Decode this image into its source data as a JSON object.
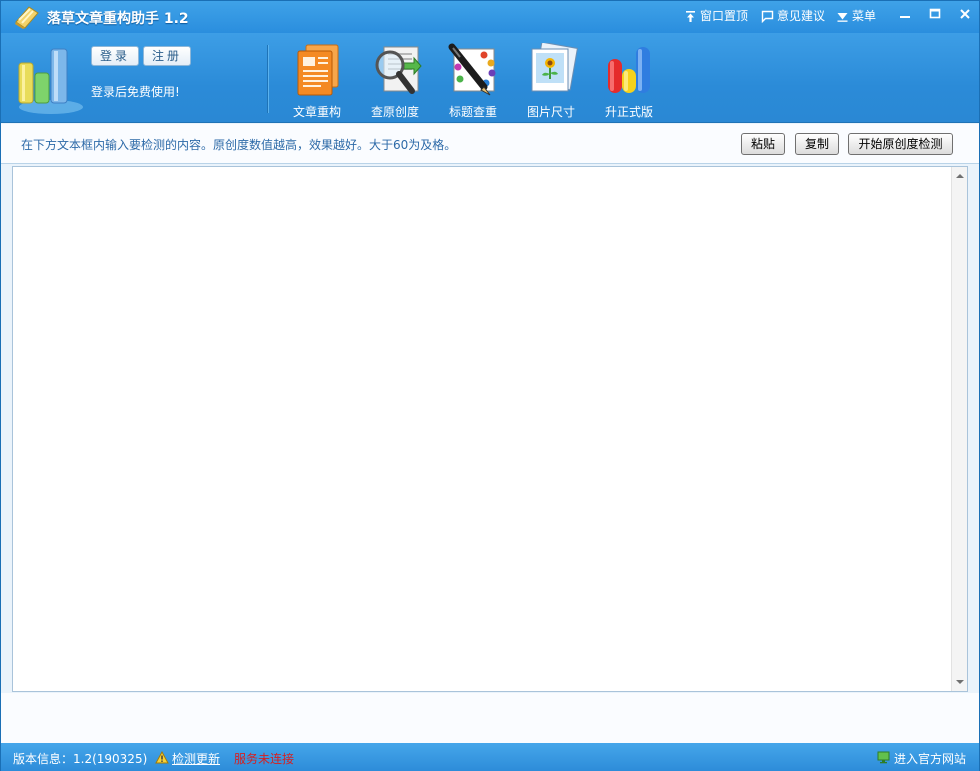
{
  "titlebar": {
    "title": "落草文章重构助手 1.2",
    "pin_label": "窗口置顶",
    "feedback_label": "意见建议",
    "menu_label": "菜单"
  },
  "auth": {
    "login_label": "登录",
    "register_label": "注册",
    "hint": "登录后免费使用!"
  },
  "tools": [
    {
      "label": "文章重构",
      "icon": "document-rewrite-icon"
    },
    {
      "label": "查原创度",
      "icon": "magnifier-check-icon"
    },
    {
      "label": "标题查重",
      "icon": "pen-title-icon"
    },
    {
      "label": "图片尺寸",
      "icon": "image-size-icon"
    },
    {
      "label": "升正式版",
      "icon": "upgrade-bars-icon"
    }
  ],
  "instruction": "在下方文本框内输入要检测的内容。原创度数值越高，效果越好。大于60为及格。",
  "actions": {
    "paste_label": "粘贴",
    "copy_label": "复制",
    "check_label": "开始原创度检测"
  },
  "editor": {
    "value": ""
  },
  "status": {
    "version_label": "版本信息：1.2(190325)",
    "update_label": "检测更新",
    "service_label": "服务未连接",
    "site_label": "进入官方网站"
  },
  "colors": {
    "accent": "#2a8ede",
    "instruction_text": "#2d6aa8",
    "error": "#d81e1e"
  }
}
